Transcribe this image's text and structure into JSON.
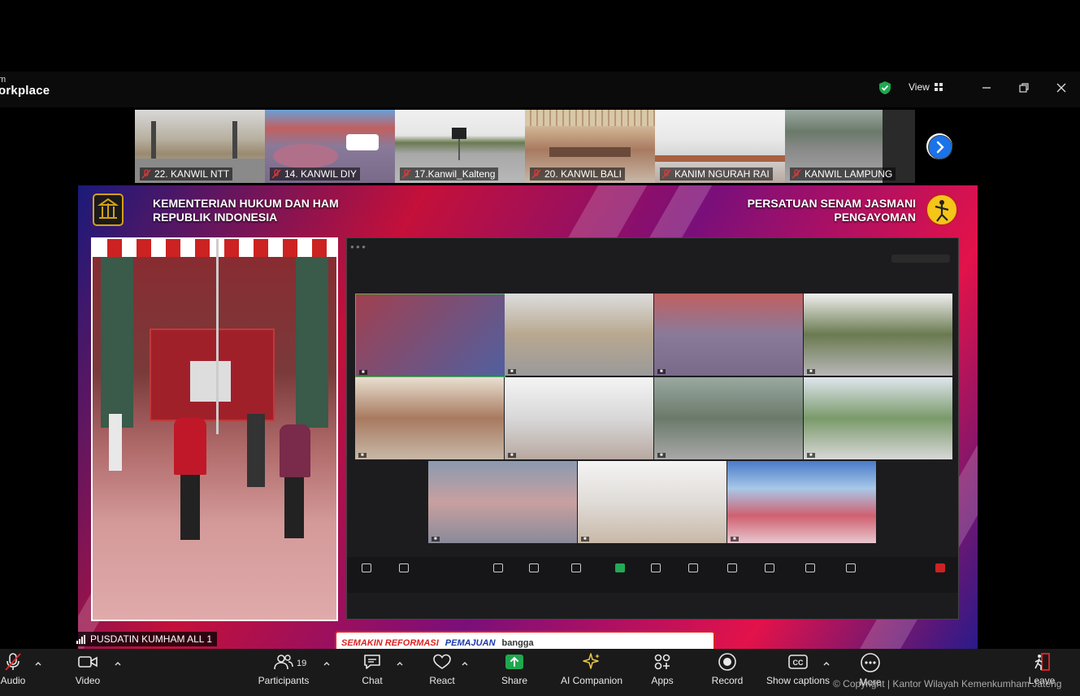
{
  "window": {
    "brand_line1": "m",
    "brand_line2": "orkplace",
    "view_label": "View",
    "accent_green": "#1fa84f",
    "accent_blue": "#1a73e8",
    "leave_color": "#e02828"
  },
  "strip": {
    "tiles": [
      {
        "label": "22. KANWIL NTT",
        "muted": true
      },
      {
        "label": "14. KANWIL DIY",
        "muted": true
      },
      {
        "label": "17.Kanwil_Kalteng",
        "muted": true
      },
      {
        "label": "20. KANWIL BALI",
        "muted": true
      },
      {
        "label": "KANIM NGURAH RAI",
        "muted": true
      },
      {
        "label": "KANWIL LAMPUNG",
        "muted": true
      }
    ],
    "next_icon": "chevron-right-icon"
  },
  "stage": {
    "header_left_line1": "KEMENTERIAN HUKUM DAN HAM",
    "header_left_line2": "REPUBLIK INDONESIA",
    "header_right_line1": "PERSATUAN SENAM JASMANI",
    "header_right_line2": "PENGAYOMAN",
    "banner_text1": "SEMAKIN REFORMASI",
    "banner_text2": "PEMAJUAN",
    "banner_text3": "bangga"
  },
  "speaker": {
    "name": "PUSDATIN KUMHAM ALL 1"
  },
  "toolbar": {
    "audio": "Audio",
    "video": "Video",
    "participants": "Participants",
    "participants_count": "19",
    "chat": "Chat",
    "react": "React",
    "share": "Share",
    "ai_companion": "AI Companion",
    "apps": "Apps",
    "record": "Record",
    "show_captions": "Show captions",
    "more": "More",
    "leave": "Leave"
  },
  "footer": {
    "copyright": "© Copyright | Kantor Wilayah Kemenkumham Jateng"
  }
}
